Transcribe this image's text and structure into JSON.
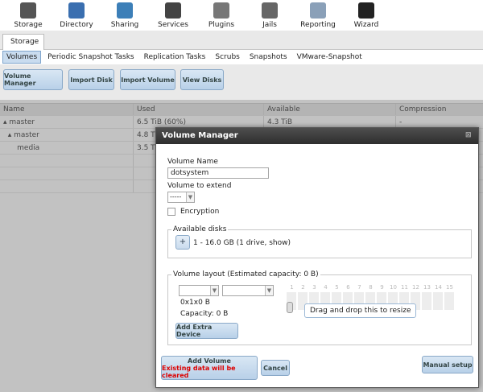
{
  "toolbar": [
    {
      "label": "Storage",
      "icon": "storage-icon",
      "color": "#555555"
    },
    {
      "label": "Directory",
      "icon": "directory-icon",
      "color": "#3a6fb0"
    },
    {
      "label": "Sharing",
      "icon": "sharing-icon",
      "color": "#3c7fb8"
    },
    {
      "label": "Services",
      "icon": "services-icon",
      "color": "#444444"
    },
    {
      "label": "Plugins",
      "icon": "plugins-icon",
      "color": "#777777"
    },
    {
      "label": "Jails",
      "icon": "jails-icon",
      "color": "#666666"
    },
    {
      "label": "Reporting",
      "icon": "reporting-icon",
      "color": "#8aa0b8"
    },
    {
      "label": "Wizard",
      "icon": "wizard-icon",
      "color": "#222222"
    }
  ],
  "storage_tab": "Storage",
  "subtabs": [
    "Volumes",
    "Periodic Snapshot Tasks",
    "Replication Tasks",
    "Scrubs",
    "Snapshots",
    "VMware-Snapshot"
  ],
  "buttons": {
    "volume_manager": "Volume Manager",
    "import_disk": "Import Disk",
    "import_volume": "Import Volume",
    "view_disks": "View Disks"
  },
  "table": {
    "columns": [
      "Name",
      "Used",
      "Available",
      "Compression"
    ],
    "rows": [
      [
        "▴ master",
        "6.5 TiB (60%)",
        "4.3 TiB",
        "-"
      ],
      [
        "  ▴ master",
        "4.8 T",
        "",
        ""
      ],
      [
        "      media",
        "3.5 T",
        "",
        ""
      ]
    ]
  },
  "dialog": {
    "title": "Volume Manager",
    "volume_name_label": "Volume Name",
    "volume_name_value": "dotsystem",
    "volume_extend_label": "Volume to extend",
    "volume_extend_value": "-----",
    "encryption_label": "Encryption",
    "available_disks_legend": "Available disks",
    "available_disks_text": "1 - 16.0 GB (1 drive, show)",
    "layout_legend": "Volume layout (Estimated capacity: 0 B)",
    "layout_size": "0x1x0 B",
    "capacity": "Capacity: 0 B",
    "slot_numbers": [
      "1",
      "2",
      "3",
      "4",
      "5",
      "6",
      "7",
      "8",
      "9",
      "10",
      "11",
      "12",
      "13",
      "14",
      "15"
    ],
    "tooltip": "Drag and drop this to resize",
    "add_extra_device": "Add Extra Device",
    "add_volume": "Add Volume",
    "add_volume_warning": "Existing data will be cleared",
    "cancel": "Cancel",
    "manual_setup": "Manual setup",
    "warning_color": "#dd0000"
  }
}
